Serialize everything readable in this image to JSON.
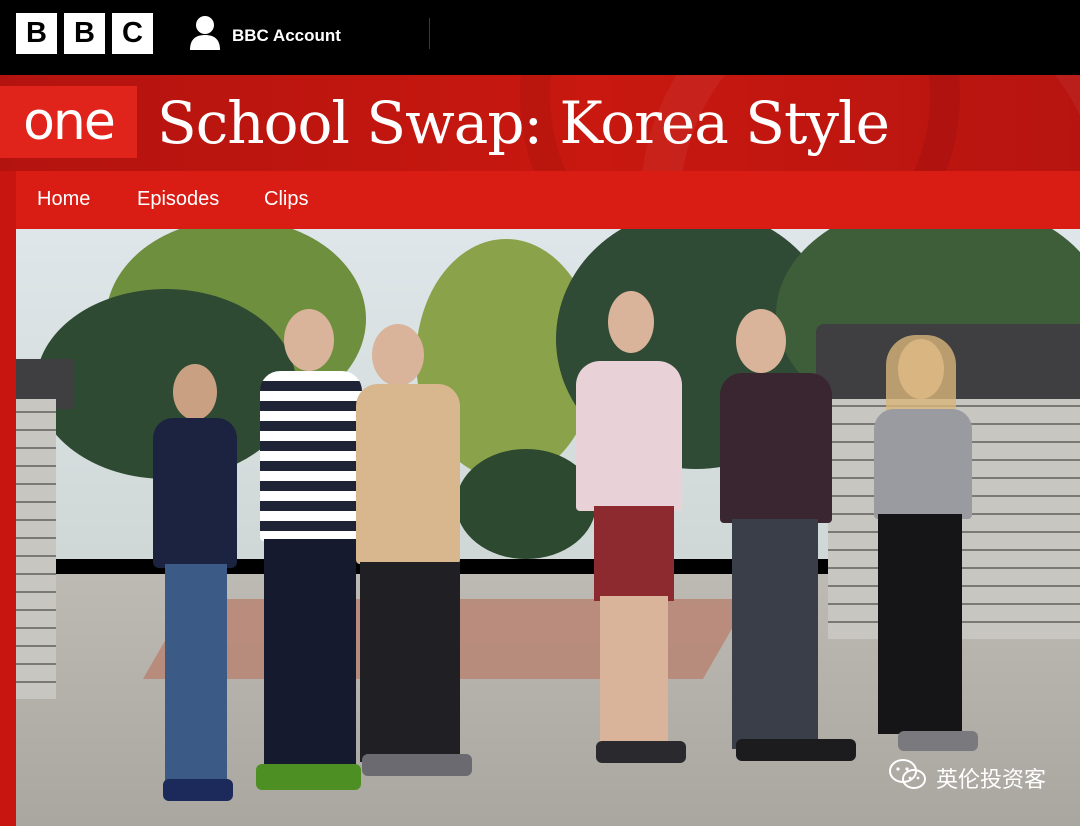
{
  "topbar": {
    "logo_letters": [
      "B",
      "B",
      "C"
    ],
    "account_label": "BBC Account"
  },
  "brand": {
    "channel_logo": "one",
    "show_title": "School Swap: Korea Style"
  },
  "nav": {
    "items": [
      {
        "label": "Home"
      },
      {
        "label": "Episodes"
      },
      {
        "label": "Clips"
      }
    ]
  },
  "watermark": {
    "text": "英伦投资客",
    "icon": "wechat-icon"
  },
  "colors": {
    "brand_red": "#d91c14",
    "topbar": "#000000",
    "one_logo": "#e0231b"
  }
}
